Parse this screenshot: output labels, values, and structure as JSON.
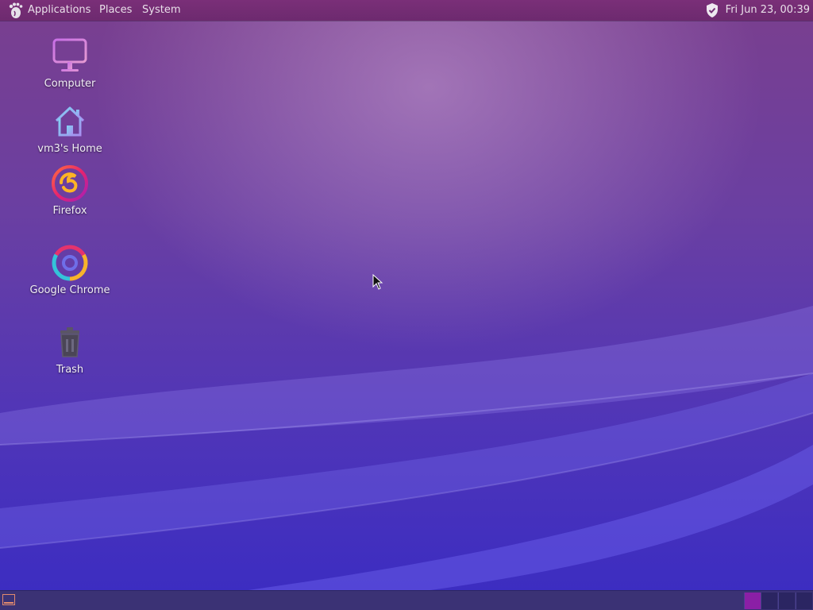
{
  "top_panel": {
    "menus": [
      "Applications",
      "Places",
      "System"
    ],
    "clock": "Fri Jun 23, 00:39",
    "colors": {
      "panel": "#722c73",
      "text": "#e9dfe9"
    }
  },
  "desktop_icons": [
    {
      "label": "Computer",
      "icon": "computer-icon"
    },
    {
      "label": "vm3's Home",
      "icon": "home-folder-icon"
    },
    {
      "label": "Firefox",
      "icon": "firefox-icon"
    },
    {
      "label": "Google Chrome",
      "icon": "chrome-icon"
    },
    {
      "label": "Trash",
      "icon": "trash-icon"
    }
  ],
  "bottom_panel": {
    "workspaces": 4,
    "active_workspace": 1,
    "colors": {
      "panel": "#3b3275",
      "active_workspace": "#8b1fa6"
    }
  }
}
